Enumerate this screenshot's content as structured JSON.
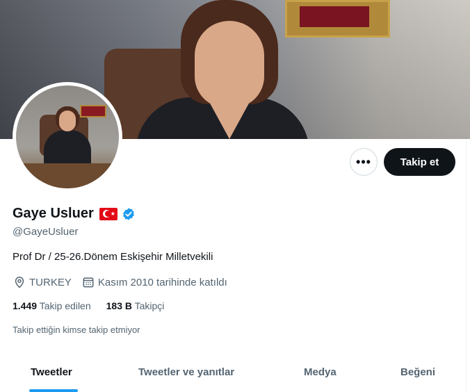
{
  "profile": {
    "name": "Gaye Usluer",
    "handle": "@GayeUsluer",
    "bio": "Prof Dr / 25-26.Dönem Eskişehir Milletvekili",
    "location": "TURKEY",
    "joined": "Kasım 2010 tarihinde katıldı",
    "following_count": "1.449",
    "following_label": "Takip edilen",
    "followers_count": "183 B",
    "followers_label": "Takipçi",
    "mutual_note": "Takip ettiğin kimse takip etmiyor"
  },
  "actions": {
    "more_label": "•••",
    "follow_label": "Takip et"
  },
  "tabs": [
    {
      "label": "Tweetler",
      "active": true
    },
    {
      "label": "Tweetler ve yanıtlar",
      "active": false
    },
    {
      "label": "Medya",
      "active": false
    },
    {
      "label": "Beğeni",
      "active": false
    }
  ],
  "icons": {
    "flag": "turkey-flag-icon",
    "verified": "verified-badge-icon",
    "location": "location-pin-icon",
    "calendar": "calendar-icon"
  },
  "colors": {
    "accent": "#1d9bf0",
    "follow_button": "#0f1419",
    "secondary_text": "#536471"
  }
}
